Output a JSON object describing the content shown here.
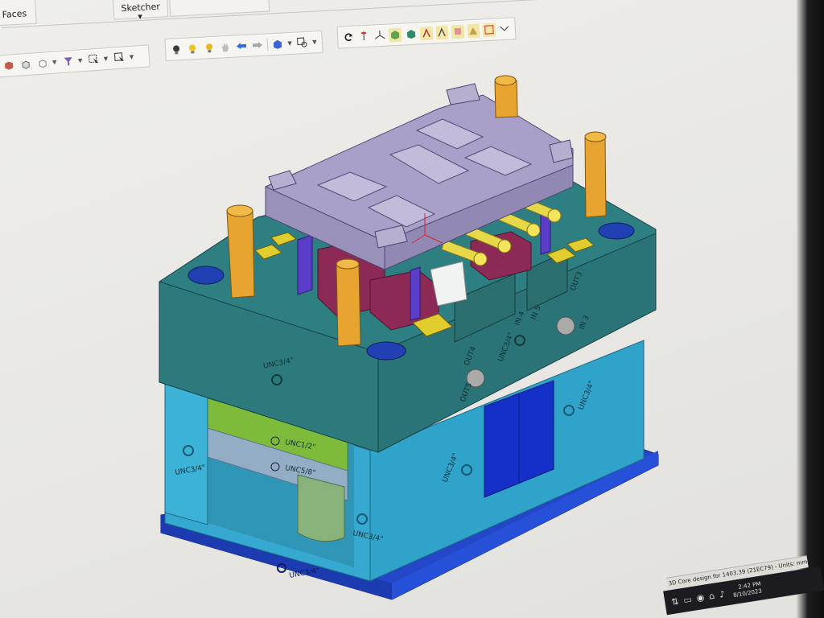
{
  "ribbon": {
    "tabs": [
      {
        "label": "Faces"
      },
      {
        "label": "Sketcher"
      },
      {
        "label": ""
      }
    ]
  },
  "toolbars": {
    "left": [
      "select-filter-icon",
      "cube-view-icon",
      "wireframe-icon",
      "filter-icon",
      "pointer-add-icon",
      "pointer-icon"
    ],
    "middle": [
      "bulb-off-icon",
      "bulb-on-icon",
      "bulb-icon",
      "hand-icon",
      "back-arrow-icon",
      "forward-arrow-icon",
      "box-icon",
      "zoom-window-icon"
    ],
    "right": [
      "rotate-icon",
      "pin-icon",
      "axes-icon",
      "shaded-icon",
      "section-icon",
      "view-front-icon",
      "view-right-icon",
      "view-top-icon",
      "view-iso-icon",
      "more-icon"
    ]
  },
  "model_labels": {
    "plate_front_left": "UNC3/4\"",
    "plate_front_right": "UNC3/4\"",
    "out4": "OUT4",
    "in4": "IN 4",
    "out5": "OUT5",
    "in5": "IN 5",
    "out3": "OUT3",
    "in3": "IN 3",
    "unc_left_block": "UNC3/4\"",
    "unc_green": "UNC1/2\"",
    "unc_grey": "UNC5/8\"",
    "unc_right_block": "UNC3/4\"",
    "unc_side_low": "UNC3/4\"",
    "unc_base": "UNC3/4\"",
    "unc_base_right": "UNC3/4\""
  },
  "status": {
    "text": "3D Core design for 1403.39 (21EC79) - Units: mm",
    "time": "2:42 PM",
    "date": "8/10/2023"
  },
  "colors": {
    "top_plate": "#a8a0c8",
    "teal_plate": "#2e7f82",
    "cyan_block": "#2fa3c9",
    "base_plate": "#2347c8",
    "pins": "#e8a431",
    "magenta": "#8c2a55",
    "green_plate": "#78b33a",
    "grey_plate": "#8fa9c2",
    "blue_insert": "#1430c8",
    "yellow_fittings": "#e7d84a"
  }
}
